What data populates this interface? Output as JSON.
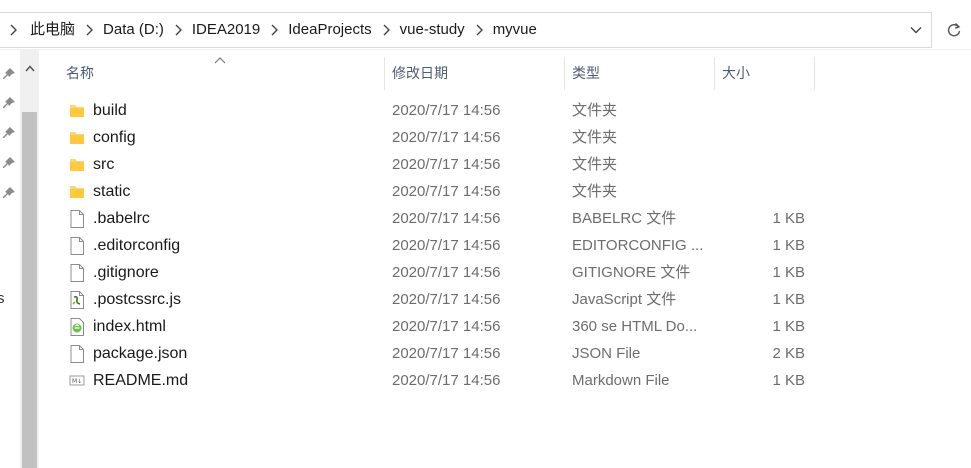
{
  "address_bar": {
    "breadcrumbs": [
      "此电脑",
      "Data (D:)",
      "IDEA2019",
      "IdeaProjects",
      "vue-study",
      "myvue"
    ]
  },
  "nav_pane": {
    "partial_label": "s"
  },
  "columns": {
    "name": "名称",
    "date": "修改日期",
    "type": "类型",
    "size": "大小"
  },
  "files": [
    {
      "name": "build",
      "date": "2020/7/17 14:56",
      "type": "文件夹",
      "size": "",
      "icon": "folder-icon"
    },
    {
      "name": "config",
      "date": "2020/7/17 14:56",
      "type": "文件夹",
      "size": "",
      "icon": "folder-icon"
    },
    {
      "name": "src",
      "date": "2020/7/17 14:56",
      "type": "文件夹",
      "size": "",
      "icon": "folder-icon"
    },
    {
      "name": "static",
      "date": "2020/7/17 14:56",
      "type": "文件夹",
      "size": "",
      "icon": "folder-icon"
    },
    {
      "name": ".babelrc",
      "date": "2020/7/17 14:56",
      "type": "BABELRC 文件",
      "size": "1 KB",
      "icon": "file-icon"
    },
    {
      "name": ".editorconfig",
      "date": "2020/7/17 14:56",
      "type": "EDITORCONFIG ...",
      "size": "1 KB",
      "icon": "file-icon"
    },
    {
      "name": ".gitignore",
      "date": "2020/7/17 14:56",
      "type": "GITIGNORE 文件",
      "size": "1 KB",
      "icon": "file-icon"
    },
    {
      "name": ".postcssrc.js",
      "date": "2020/7/17 14:56",
      "type": "JavaScript 文件",
      "size": "1 KB",
      "icon": "js-file-icon"
    },
    {
      "name": "index.html",
      "date": "2020/7/17 14:56",
      "type": "360 se HTML Do...",
      "size": "1 KB",
      "icon": "html-file-icon"
    },
    {
      "name": "package.json",
      "date": "2020/7/17 14:56",
      "type": "JSON File",
      "size": "2 KB",
      "icon": "file-icon"
    },
    {
      "name": "README.md",
      "date": "2020/7/17 14:56",
      "type": "Markdown File",
      "size": "1 KB",
      "icon": "markdown-file-icon"
    }
  ],
  "colors": {
    "folder": "#f8d775",
    "header_text": "#4d5b73",
    "detail_text": "#6d6d6d"
  }
}
